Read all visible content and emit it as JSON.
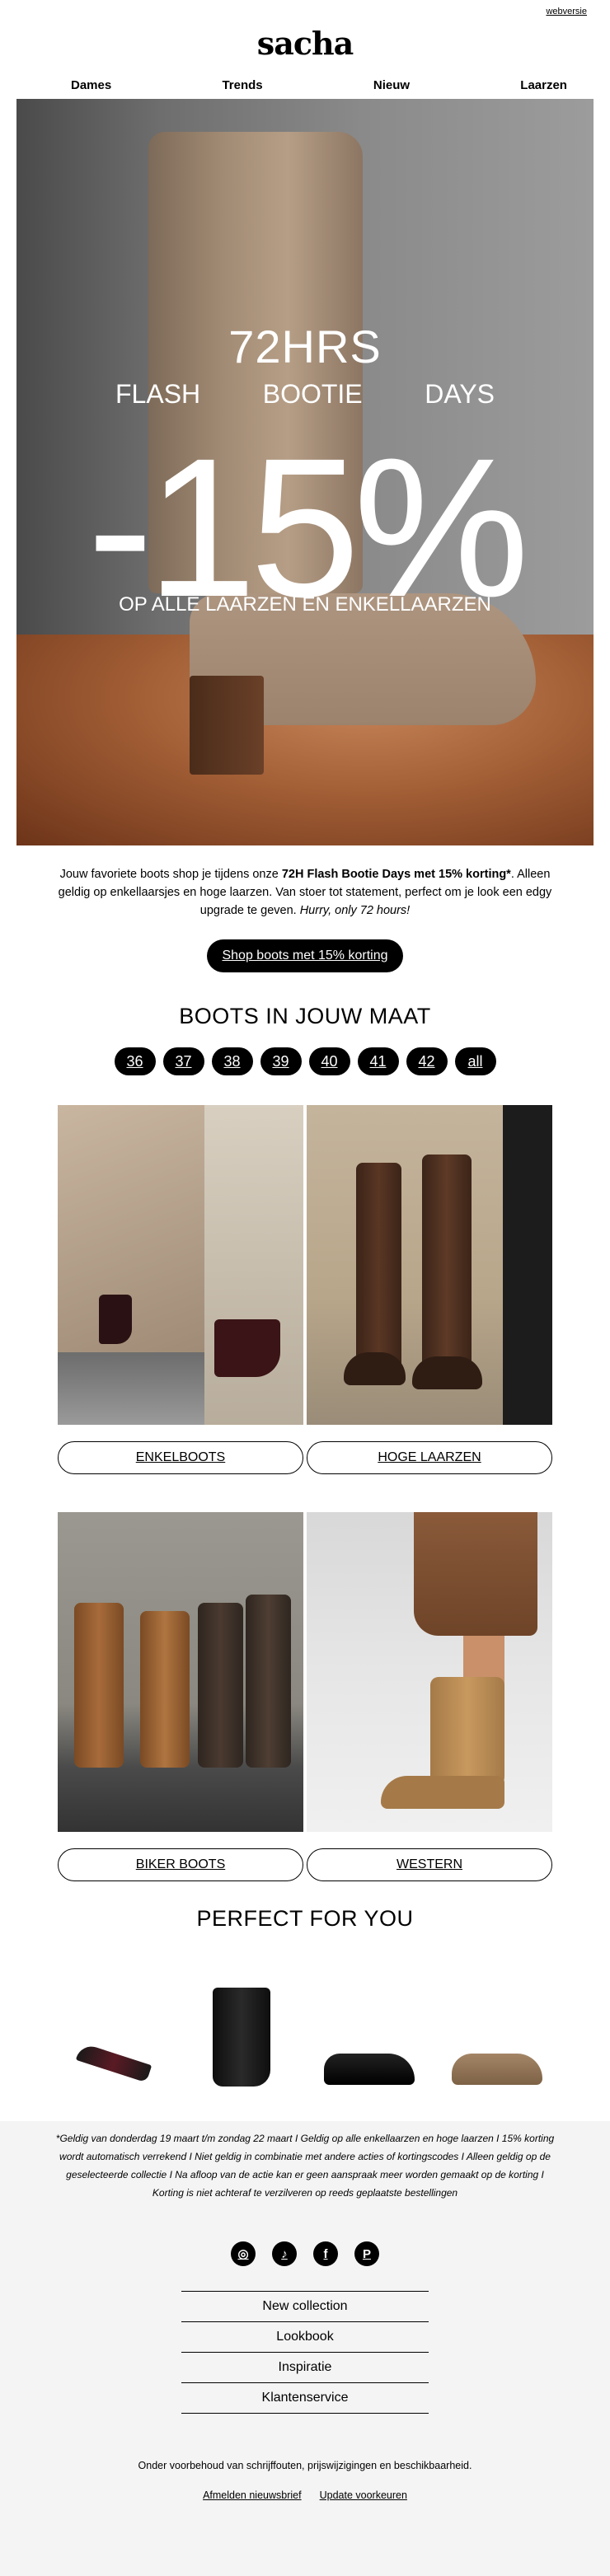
{
  "header": {
    "webversie": "webversie",
    "logo": "sacha"
  },
  "nav": {
    "items": [
      "Dames",
      "Trends",
      "Nieuw",
      "Laarzen"
    ]
  },
  "hero": {
    "line1": "72HRS",
    "words": [
      "FLASH",
      "BOOTIE",
      "DAYS"
    ],
    "discount": "-15%",
    "subline": "OP ALLE LAARZEN EN ENKELLAARZEN"
  },
  "intro": {
    "part1": "Jouw favoriete boots shop je tijdens onze ",
    "bold": "72H Flash Bootie Days met 15% korting*",
    "part2": ". Alleen geldig op enkellaarsjes en hoge laarzen. Van stoer tot statement, perfect om je look een edgy upgrade te geven. ",
    "italic": "Hurry, only 72 hours!"
  },
  "cta": {
    "label": "Shop boots met 15% korting"
  },
  "sizes": {
    "title": "BOOTS IN JOUW MAAT",
    "items": [
      "36",
      "37",
      "38",
      "39",
      "40",
      "41",
      "42",
      "all"
    ]
  },
  "categories": [
    {
      "label": "ENKELBOOTS"
    },
    {
      "label": "HOGE LAARZEN"
    },
    {
      "label": "BIKER BOOTS"
    },
    {
      "label": "WESTERN"
    }
  ],
  "perfect": {
    "title": "PERFECT FOR YOU"
  },
  "footer": {
    "disclaimer": "*Geldig van donderdag 19 maart t/m zondag 22 maart I Geldig op alle enkellaarzen en hoge laarzen I 15% korting wordt automatisch verrekend I Niet geldig in combinatie met andere acties of kortingscodes I Alleen geldig op de geselecteerde collectie I Na afloop van de actie kan er geen aanspraak meer worden gemaakt op de korting I Korting is niet achteraf te verzilveren op reeds geplaatste bestellingen",
    "social": [
      {
        "icon": "instagram-icon",
        "glyph": "◎"
      },
      {
        "icon": "tiktok-icon",
        "glyph": "♪"
      },
      {
        "icon": "facebook-icon",
        "glyph": "f"
      },
      {
        "icon": "pinterest-icon",
        "glyph": "P"
      }
    ],
    "links": [
      "New collection",
      "Lookbook",
      "Inspiratie",
      "Klantenservice"
    ],
    "legal": "Onder voorbehoud van schrijffouten, prijswijzigingen en beschikbaarheid.",
    "unsubscribe": "Afmelden nieuwsbrief",
    "preferences": "Update voorkeuren"
  },
  "colors": {
    "background": "#ffffff",
    "footer_bg": "#f4f4f4",
    "accent": "#000000"
  }
}
